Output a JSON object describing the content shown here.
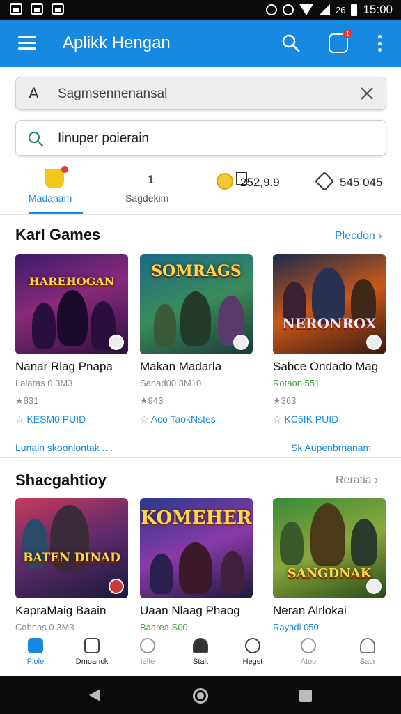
{
  "status_bar": {
    "time": "15:00",
    "network": "26"
  },
  "app_bar": {
    "title": "Aplikk Hengan",
    "notification_count": "1"
  },
  "search_primary": {
    "lead": "A",
    "value": "Sagmsennenansal"
  },
  "search_secondary": {
    "value": "Iinuper poierain"
  },
  "tabs": [
    {
      "label": "Madanam",
      "active": true
    },
    {
      "icon_value": "1",
      "label": "Sagdekim"
    },
    {
      "value": "252,9.9"
    },
    {
      "value": "545 045"
    }
  ],
  "section1": {
    "title": "Karl Games",
    "link": "Plecdon",
    "cards": [
      {
        "logo": "HAREHOGAN",
        "name": "Nanar Rlag Pnapa",
        "meta": "Lalaras 0.3M3",
        "rating": "831",
        "price": "KESM0 PUID"
      },
      {
        "logo": "SOMRAGS",
        "name": "Makan Madarla",
        "meta": "Sanad00 3M10",
        "rating": "943",
        "price": "Aco TaokNstes"
      },
      {
        "logo": "NERONROX",
        "name": "Sabce Ondado Mag",
        "meta": "Rotaon 551",
        "rating": "363",
        "price": "KC5IK PUID"
      }
    ],
    "footer_left": "Lunain skoonlontak",
    "footer_right": "Sk Aupenbrnanam"
  },
  "section2": {
    "title": "Shacgahtioy",
    "link": "Reratia",
    "cards": [
      {
        "logo": "BATEN DINAD",
        "name": "KapraMaig Baain",
        "meta": "Cohnas 0 3M3"
      },
      {
        "logo": "KOMEHER",
        "name": "Uaan Nlaag Phaog",
        "meta": "Baarea S00"
      },
      {
        "logo": "SANGDNAK",
        "name": "Neran Alrlokai",
        "meta": "Rayadi 050"
      }
    ]
  },
  "bottom_nav": [
    {
      "label": "Piole",
      "active": true
    },
    {
      "label": "Dmoanck"
    },
    {
      "label": "Ielte"
    },
    {
      "label": "Stalt"
    },
    {
      "label": "Hegst"
    },
    {
      "label": "Atoo"
    },
    {
      "label": "Sacr"
    }
  ],
  "colors": {
    "primary": "#1789e0",
    "accent_green": "#3aa83a",
    "badge": "#e53935"
  }
}
